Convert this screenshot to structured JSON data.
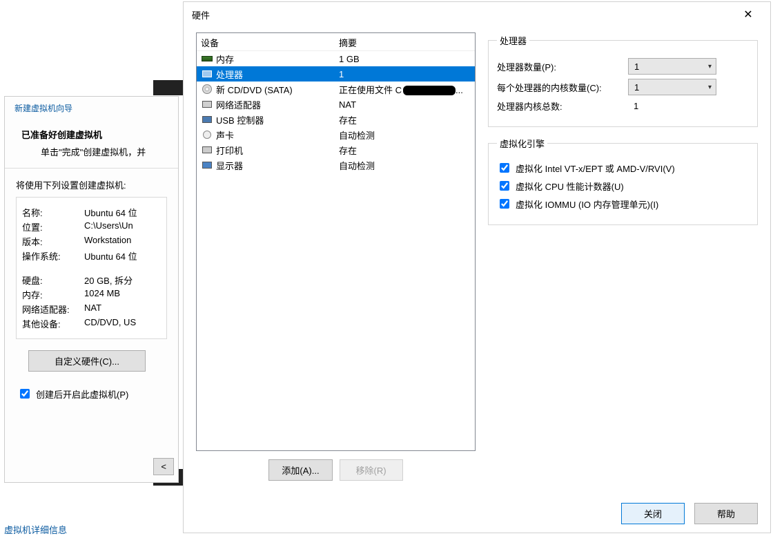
{
  "wizard": {
    "header_tab": "新建虚拟机向导",
    "title": "已准备好创建虚拟机",
    "subtitle": "单击\"完成\"创建虚拟机，并",
    "use_settings_label": "将使用下列设置创建虚拟机:",
    "rows": [
      {
        "k": "名称:",
        "v": "Ubuntu 64 位"
      },
      {
        "k": "位置:",
        "v": "C:\\Users\\Un"
      },
      {
        "k": "版本:",
        "v": "Workstation "
      },
      {
        "k": "操作系统:",
        "v": "Ubuntu 64 位"
      }
    ],
    "rows2": [
      {
        "k": "硬盘:",
        "v": "20 GB, 拆分"
      },
      {
        "k": "内存:",
        "v": "1024 MB"
      },
      {
        "k": "网络适配器:",
        "v": "NAT"
      },
      {
        "k": "其他设备:",
        "v": "CD/DVD, US"
      }
    ],
    "customize_btn": "自定义硬件(C)...",
    "open_after_label": "创建后开启此虚拟机(P)",
    "back_btn": "<"
  },
  "bottom_link": "虚拟机详细信息",
  "hw": {
    "title": "硬件",
    "close_x": "✕",
    "col_device": "设备",
    "col_summary": "摘要",
    "devices": [
      {
        "icon": "memory-icon",
        "name": "内存",
        "summary": "1 GB",
        "selected": false
      },
      {
        "icon": "cpu-icon",
        "name": "处理器",
        "summary": "1",
        "selected": true
      },
      {
        "icon": "disc-icon",
        "name": "新 CD/DVD (SATA)",
        "summary": "正在使用文件 C",
        "selected": false,
        "redacted_tail": true,
        "tail": "..."
      },
      {
        "icon": "network-icon",
        "name": "网络适配器",
        "summary": "NAT",
        "selected": false
      },
      {
        "icon": "usb-icon",
        "name": "USB 控制器",
        "summary": "存在",
        "selected": false
      },
      {
        "icon": "sound-icon",
        "name": "声卡",
        "summary": "自动检测",
        "selected": false
      },
      {
        "icon": "printer-icon",
        "name": "打印机",
        "summary": "存在",
        "selected": false
      },
      {
        "icon": "display-icon",
        "name": "显示器",
        "summary": "自动检测",
        "selected": false
      }
    ],
    "add_btn": "添加(A)...",
    "remove_btn": "移除(R)",
    "right": {
      "processors_legend": "处理器",
      "proc_count_label": "处理器数量(P):",
      "proc_count_value": "1",
      "cores_label": "每个处理器的内核数量(C):",
      "cores_value": "1",
      "total_label": "处理器内核总数:",
      "total_value": "1",
      "virt_legend": "虚拟化引擎",
      "chk_vt": "虚拟化 Intel VT-x/EPT 或 AMD-V/RVI(V)",
      "chk_perf": "虚拟化 CPU 性能计数器(U)",
      "chk_iommu": "虚拟化 IOMMU (IO 内存管理单元)(I)"
    },
    "close_btn": "关闭",
    "help_btn": "帮助"
  },
  "watermark": ""
}
